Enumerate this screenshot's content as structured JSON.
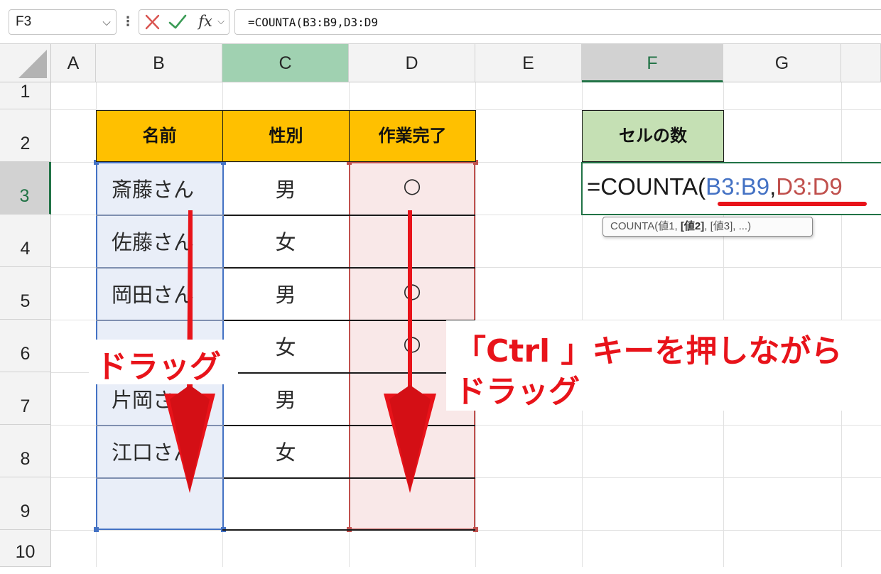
{
  "formula_bar": {
    "name_box": "F3",
    "formula": "=COUNTA(B3:B9,D3:D9",
    "fx_label": "fx"
  },
  "columns": [
    "A",
    "B",
    "C",
    "D",
    "E",
    "F",
    "G"
  ],
  "rows": [
    "1",
    "2",
    "3",
    "4",
    "5",
    "6",
    "7",
    "8",
    "9",
    "10"
  ],
  "table": {
    "headers": [
      "名前",
      "性別",
      "作業完了"
    ],
    "names": [
      "斎藤さん",
      "佐藤さん",
      "岡田さん",
      "",
      "片岡さん",
      "江口さん",
      ""
    ],
    "genders": [
      "男",
      "女",
      "男",
      "女",
      "男",
      "女",
      ""
    ],
    "done": [
      "○",
      "",
      "○",
      "○",
      "○",
      "",
      ""
    ]
  },
  "result": {
    "header": "セルの数",
    "formula_prefix": "=COUNTA(",
    "range1": "B3:B9",
    "separator": ",",
    "range2": "D3:D9",
    "tooltip_func": "COUNTA(値1, ",
    "tooltip_bold": "[値2]",
    "tooltip_rest": ", [値3], ...)"
  },
  "annotations": {
    "drag_left": "ドラッグ",
    "ctrl_line1": "「Ctrl 」キーを押しながら",
    "ctrl_line2": "ドラッグ"
  },
  "colors": {
    "header_fill": "#ffc000",
    "result_header_fill": "#c5e0b4",
    "range1": "#4472c4",
    "range2": "#c0504d",
    "annotation": "#e8131a",
    "active_green": "#217346"
  }
}
